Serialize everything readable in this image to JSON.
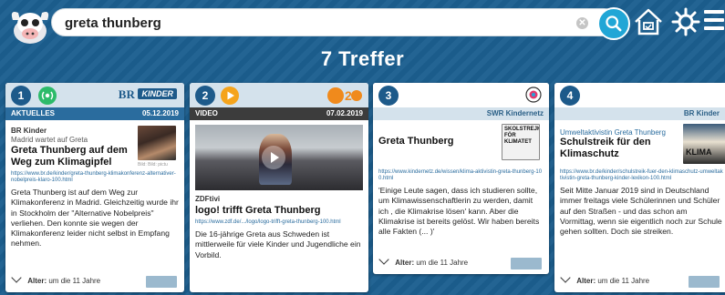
{
  "search": {
    "query": "greta thunberg"
  },
  "header": {
    "hits_title": "7 Treffer"
  },
  "cards": [
    {
      "number": "1",
      "brand": "BR KINDER",
      "category": "AKTUELLES",
      "date": "05.12.2019",
      "source": "BR Kinder",
      "kicker": "Madrid wartet auf Greta",
      "title": "Greta Thunberg auf dem Weg zum Klimagipfel",
      "image_credit": "Bild: Bild: pictu",
      "url": "https://www.br.de/kinder/greta-thunberg-klimakonferenz-alternativer-nobelpreis-klaro-100.html",
      "text": "Greta Thunberg ist auf dem Weg zur Klimakonferenz in Madrid. Gleichzeitig wurde ihr in Stockholm der \"Alternative Nobelpreis\" verliehen. Den konnte sie wegen der Klimakonferenz leider nicht selbst in Empfang nehmen.",
      "age_label": "Alter:",
      "age_value": "um die 11 Jahre"
    },
    {
      "number": "2",
      "brand": "ZDF",
      "category": "VIDEO",
      "date": "07.02.2019",
      "source": "ZDFtivi",
      "title": "logo! trifft Greta Thunberg",
      "url": "https://www.zdf.de/.../logo/logo-trifft-greta-thunberg-100.html",
      "text": "Die 16-jährige Greta aus Schweden ist mittlerweile für viele Kinder und Jugendliche ein Vorbild."
    },
    {
      "number": "3",
      "category_right": "SWR Kindernetz",
      "title": "Greta Thunberg",
      "thumb_text": "SKOLSTREJK FÖR KLIMATET",
      "url": "https://www.kindernetz.de/wissen/klima-aktivistin-greta-thunberg-100.html",
      "text": "'Einige Leute sagen, dass ich studieren sollte, um Klimawissenschaftlerin zu werden, damit ich , die Klimakrise lösen' kann. Aber die Klimakrise ist bereits gelöst. Wir haben bereits alle Fakten (... )'",
      "age_label": "Alter:",
      "age_value": "um die 11 Jahre"
    },
    {
      "number": "4",
      "category_right": "BR Kinder",
      "kicker": "Umweltaktivistin Greta Thunberg",
      "title": "Schulstreik für den Klimaschutz",
      "thumb_text": "KLIMA",
      "url": "https://www.br.de/kinder/schulstreik-fuer-den-klimaschutz-umweltaktivistin-greta-thunberg-kinder-lexikon-100.html",
      "text": "Seit Mitte Januar 2019 sind in Deutschland immer freitags viele Schülerinnen und Schüler auf den Straßen - und das schon am Vormittag, wenn sie eigentlich noch zur Schule gehen sollten. Doch sie streiken.",
      "age_label": "Alter:",
      "age_value": "um die 11 Jahre"
    }
  ],
  "colors": {
    "page_bg": "#1c5f8f",
    "accent": "#21a6d6",
    "card_head": "#d4e2ec",
    "subbar_blue": "#2a6c9e",
    "zdf_orange": "#f08a1c"
  },
  "icons": [
    "mascot-icon",
    "search-icon",
    "home-icon",
    "gear-icon",
    "menu-icon",
    "radio-icon",
    "play-icon",
    "swr-icon"
  ]
}
